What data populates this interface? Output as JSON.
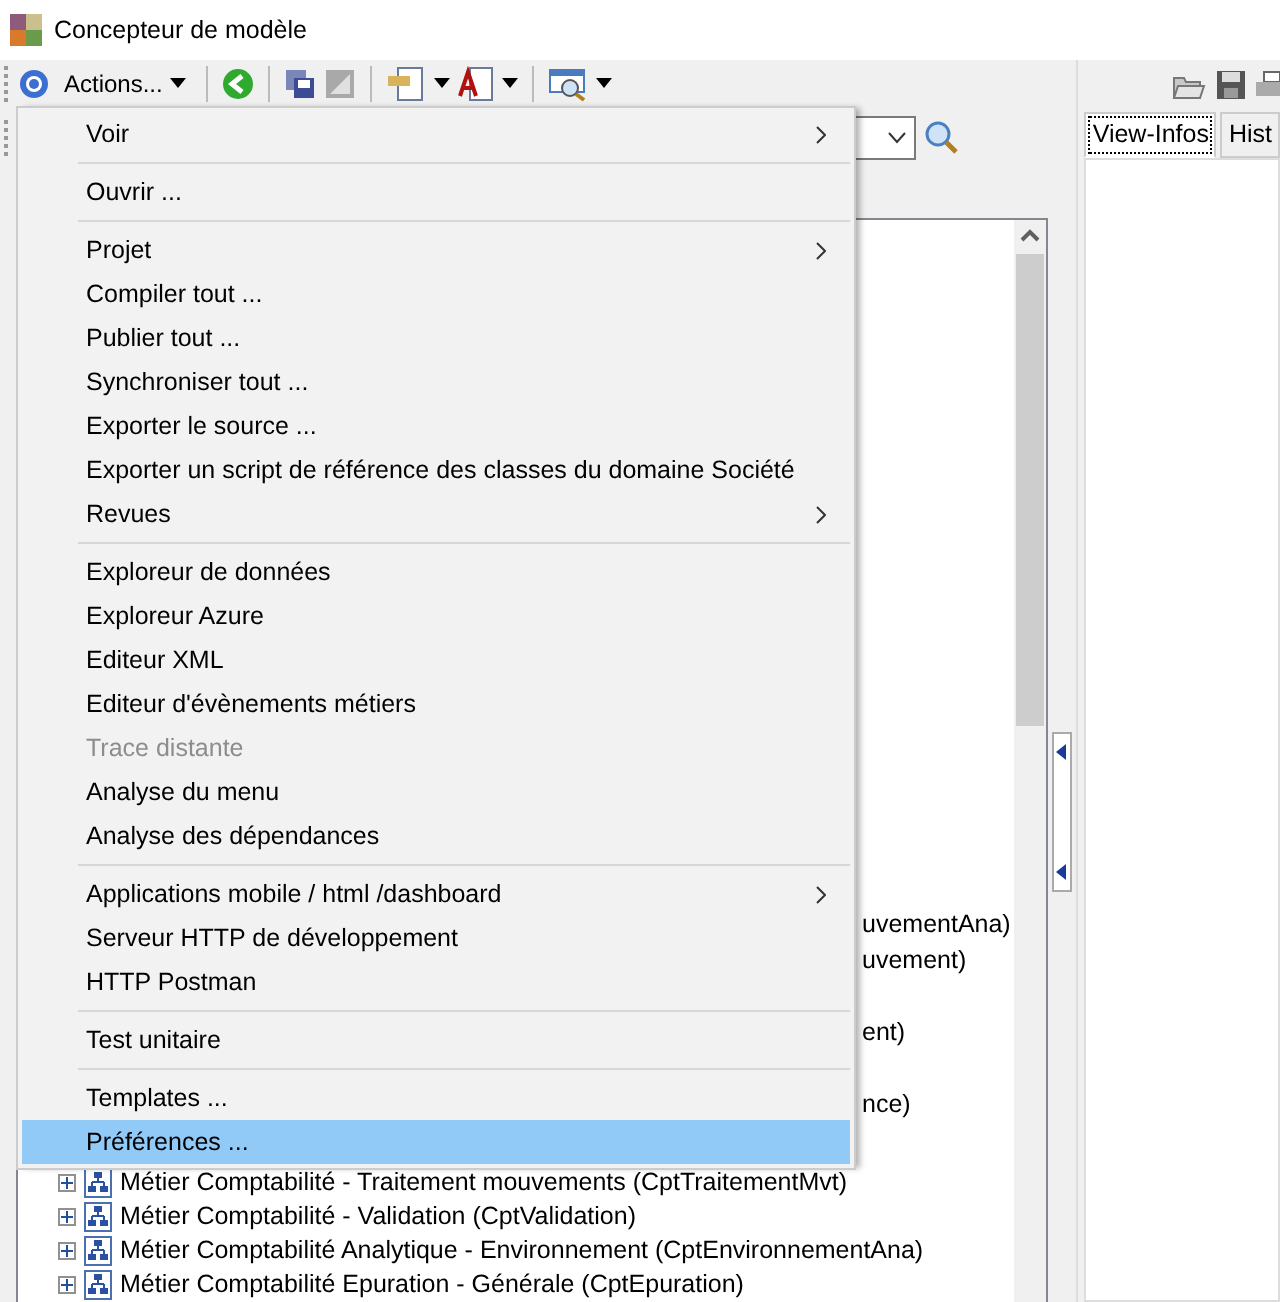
{
  "window": {
    "title": "Concepteur de modèle"
  },
  "toolbar": {
    "actions_label": "Actions..."
  },
  "right_panel": {
    "tabs": [
      {
        "label": "View-Infos",
        "selected": true
      },
      {
        "label": "Hist",
        "selected": false
      }
    ]
  },
  "tree": {
    "covered_rows": [
      {
        "text": "uvementAna)"
      },
      {
        "text": "uvement)"
      },
      {
        "text": "ent)"
      },
      {
        "text": "nce)"
      }
    ],
    "rows": [
      {
        "text": "Métier Comptabilité - Traitement mouvements (CptTraitementMvt)",
        "expanded": false
      },
      {
        "text": "Métier Comptabilité - Validation (CptValidation)",
        "expanded": false
      },
      {
        "text": "Métier Comptabilité Analytique - Environnement (CptEnvironnementAna)",
        "expanded": false
      },
      {
        "text": "Métier Comptabilité Epuration - Générale (CptEpuration)",
        "expanded": false
      }
    ]
  },
  "menu": {
    "items": [
      {
        "kind": "item",
        "label": "Voir",
        "submenu": true
      },
      {
        "kind": "separator"
      },
      {
        "kind": "item",
        "label": "Ouvrir ..."
      },
      {
        "kind": "separator"
      },
      {
        "kind": "item",
        "label": "Projet",
        "submenu": true
      },
      {
        "kind": "item",
        "label": "Compiler tout ..."
      },
      {
        "kind": "item",
        "label": "Publier tout ..."
      },
      {
        "kind": "item",
        "label": "Synchroniser tout ..."
      },
      {
        "kind": "item",
        "label": "Exporter le source ..."
      },
      {
        "kind": "item",
        "label": "Exporter un script de référence des classes du domaine Société"
      },
      {
        "kind": "item",
        "label": "Revues",
        "submenu": true
      },
      {
        "kind": "separator"
      },
      {
        "kind": "item",
        "label": "Exploreur de données"
      },
      {
        "kind": "item",
        "label": "Exploreur Azure"
      },
      {
        "kind": "item",
        "label": "Editeur XML"
      },
      {
        "kind": "item",
        "label": "Editeur d'évènements métiers"
      },
      {
        "kind": "item",
        "label": "Trace distante",
        "disabled": true
      },
      {
        "kind": "item",
        "label": "Analyse du menu"
      },
      {
        "kind": "item",
        "label": "Analyse des dépendances"
      },
      {
        "kind": "separator"
      },
      {
        "kind": "item",
        "label": "Applications mobile / html /dashboard",
        "submenu": true
      },
      {
        "kind": "item",
        "label": "Serveur HTTP de développement"
      },
      {
        "kind": "item",
        "label": "HTTP Postman"
      },
      {
        "kind": "separator"
      },
      {
        "kind": "item",
        "label": "Test unitaire"
      },
      {
        "kind": "separator"
      },
      {
        "kind": "item",
        "label": "Templates ..."
      },
      {
        "kind": "item",
        "label": "Préférences ...",
        "selected": true
      }
    ]
  }
}
